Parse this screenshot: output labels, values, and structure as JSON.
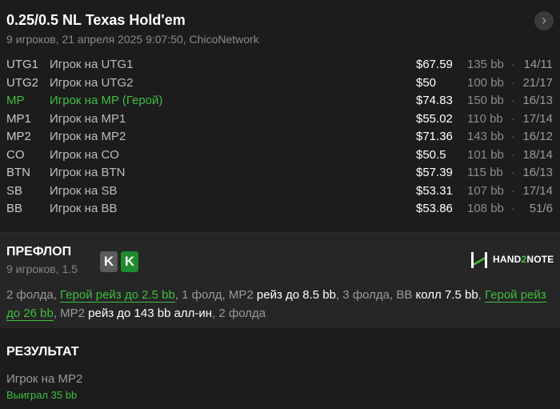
{
  "header": {
    "title": "0.25/0.5 NL Texas Hold'em",
    "subtitle": "9 игроков, 21 апреля 2025 9:07:50, ChicoNetwork",
    "next_icon": "chevron-right-icon"
  },
  "players": [
    {
      "pos": "UTG1",
      "name": "Игрок на UTG1",
      "stack": "$67.59",
      "bb": "135 bb",
      "dot": "·",
      "cards": "14/11"
    },
    {
      "pos": "UTG2",
      "name": "Игрок на UTG2",
      "stack": "$50",
      "bb": "100 bb",
      "dot": "·",
      "cards": "21/17"
    },
    {
      "pos": "MP",
      "name": "Игрок на MP (Герой)",
      "stack": "$74.83",
      "bb": "150 bb",
      "dot": "·",
      "cards": "16/13",
      "hero": true
    },
    {
      "pos": "MP1",
      "name": "Игрок на MP1",
      "stack": "$55.02",
      "bb": "110 bb",
      "dot": "·",
      "cards": "17/14"
    },
    {
      "pos": "MP2",
      "name": "Игрок на MP2",
      "stack": "$71.36",
      "bb": "143 bb",
      "dot": "·",
      "cards": "16/12"
    },
    {
      "pos": "CO",
      "name": "Игрок на CO",
      "stack": "$50.5",
      "bb": "101 bb",
      "dot": "·",
      "cards": "18/14"
    },
    {
      "pos": "BTN",
      "name": "Игрок на BTN",
      "stack": "$57.39",
      "bb": "115 bb",
      "dot": "·",
      "cards": "16/13"
    },
    {
      "pos": "SB",
      "name": "Игрок на SB",
      "stack": "$53.31",
      "bb": "107 bb",
      "dot": "·",
      "cards": "17/14"
    },
    {
      "pos": "BB",
      "name": "Игрок на BB",
      "stack": "$53.86",
      "bb": "108 bb",
      "dot": "·",
      "cards": "51/6"
    }
  ],
  "preflop": {
    "title": "ПРЕФЛОП",
    "subtitle": "9 игроков, 1.5",
    "hero_cards": [
      "K",
      "K"
    ],
    "logo_text_1": "HAND",
    "logo_text_2": "2",
    "logo_text_3": "NOTE",
    "actions": {
      "a1": "2 фолда, ",
      "a2": "Герой рейз до 2.5 bb",
      "a3": ", 1 фолд, ",
      "a4": "MP2 ",
      "a5": "рейз до 8.5 bb",
      "a6": ", 3 фолда, ",
      "a7": "BB ",
      "a8": "колл 7.5 bb",
      "a9": ", ",
      "a10": "Герой рейз до 26 bb",
      "a11": ", MP2 ",
      "a12": "рейз до 143 bb алл-ин",
      "a13": ", 2 фолда"
    }
  },
  "result": {
    "title": "РЕЗУЛЬТАТ",
    "player": "Игрок на MP2",
    "won": "Выиграл 35 bb"
  },
  "colors": {
    "hero_green": "#3fbd3f",
    "background": "#1b1b1b",
    "section_bg": "#262626"
  }
}
